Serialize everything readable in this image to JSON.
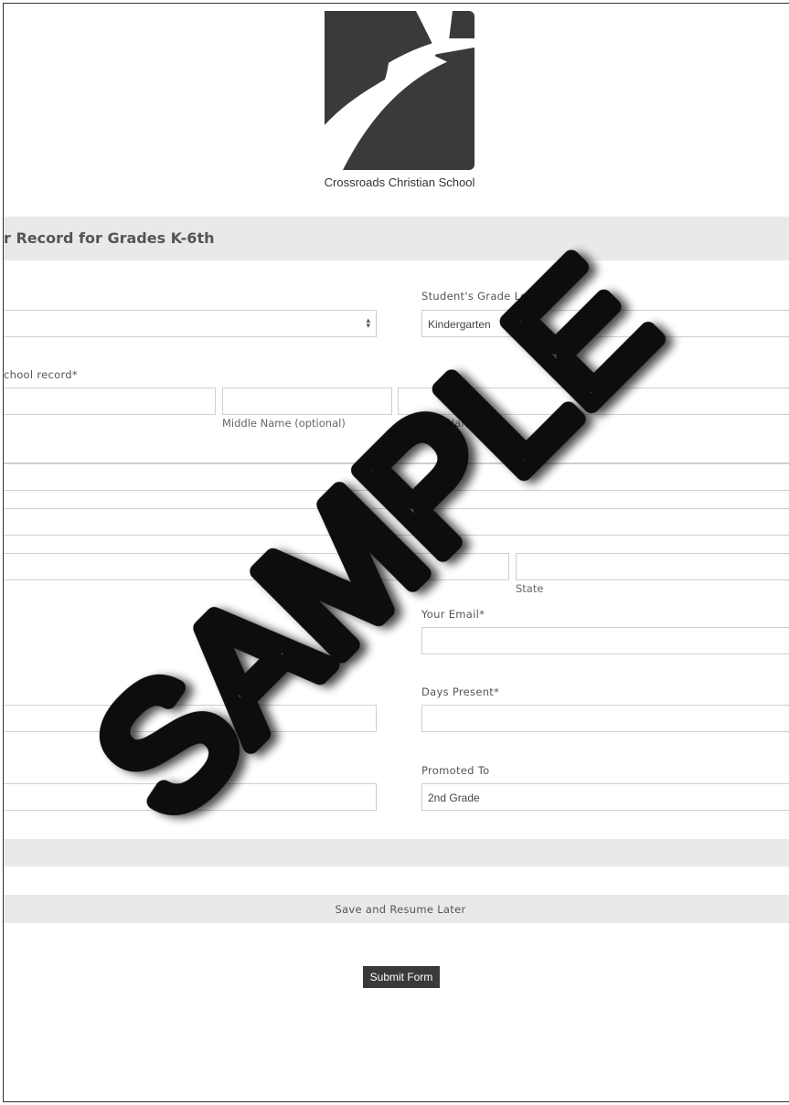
{
  "header": {
    "school_name": "Crossroads Christian School"
  },
  "form": {
    "title": "r Record for Grades K-6th",
    "grade_level_label": "Student's Grade Level",
    "grade_level_value": "Kindergarten",
    "record_label": "chool record",
    "middle_name_sublabel": "Middle Name (optional)",
    "last_name_sublabel": "Last Name",
    "state_sublabel": "State",
    "email_label": "Your Email",
    "days_present_label": "Days Present",
    "promoted_to_label": "Promoted To",
    "promoted_to_value": "2nd Grade",
    "required_mark": "*",
    "save_resume_label": "Save and Resume Later",
    "submit_label": "Submit Form"
  },
  "watermark": {
    "text": "SAMPLE"
  },
  "colors": {
    "logo": "#3a3a3a",
    "band": "#e9e9e9",
    "submit_bg": "#3a3a3a",
    "watermark": "#000000"
  },
  "icons": {
    "select_arrows": "chevron-up-down-icon",
    "logo": "crossroads-logo-icon"
  }
}
